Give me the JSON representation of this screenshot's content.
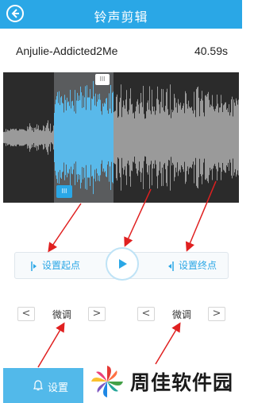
{
  "header": {
    "title": "铃声剪辑",
    "back_icon": "back-arrow-icon"
  },
  "track": {
    "name": "Anjulie-Addicted2Me",
    "duration": "40.59s"
  },
  "waveform": {
    "handle_top_label": "lll",
    "handle_bottom_label": "lll",
    "colors": {
      "background": "#2b2b2b",
      "wave": "#9a9a9a",
      "selected_wave": "#2aa7e6"
    }
  },
  "controls": {
    "set_start_label": "设置起点",
    "set_end_label": "设置终点",
    "play_icon": "play-icon"
  },
  "fine_tune": {
    "left": {
      "prev": "<",
      "label": "微调",
      "next": ">"
    },
    "right": {
      "prev": "<",
      "label": "微调",
      "next": ">"
    }
  },
  "bottom": {
    "set_label": "设置",
    "bell_icon": "bell-icon"
  },
  "watermark": {
    "text": "周佳软件园"
  },
  "colors": {
    "accent": "#2aa7e6",
    "annotation": "#e02020"
  }
}
